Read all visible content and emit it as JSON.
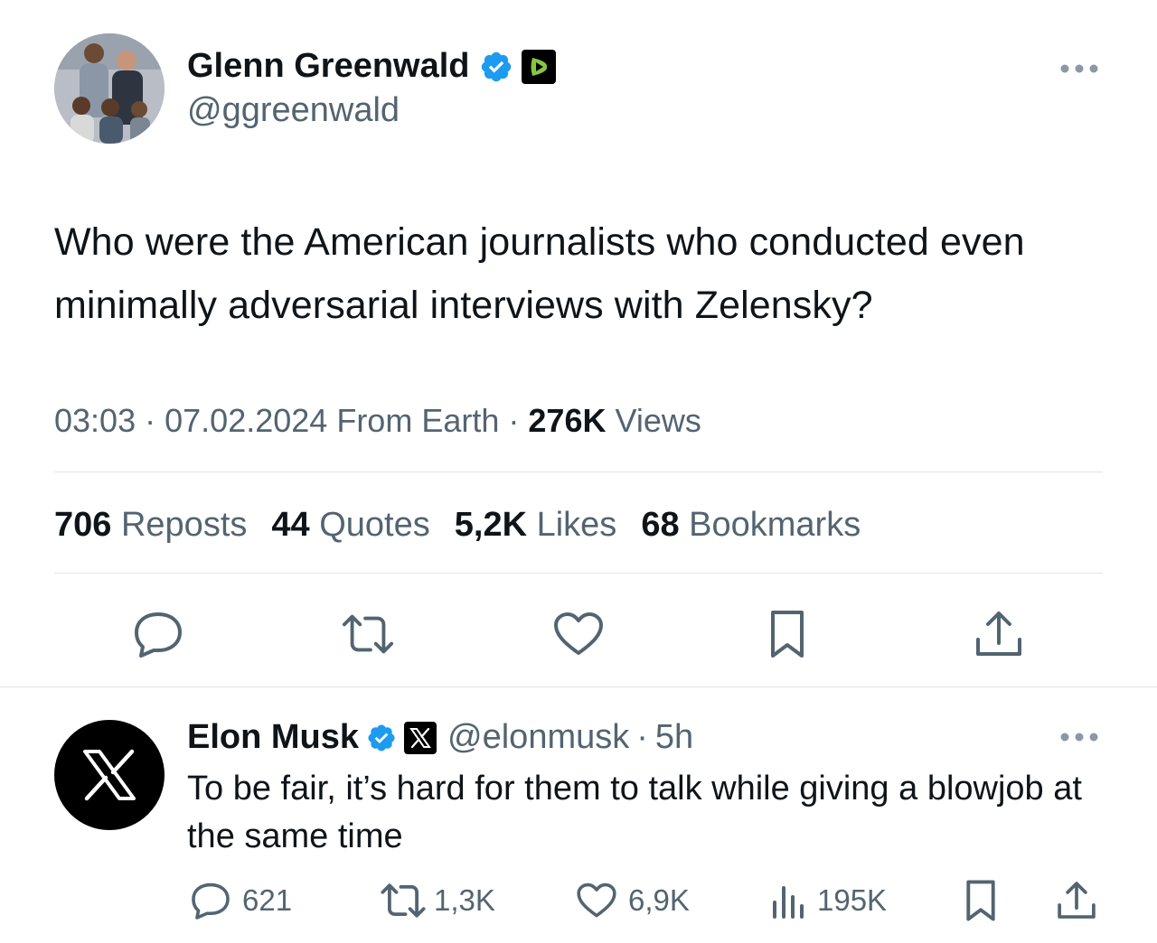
{
  "tweet": {
    "author_name": "Glenn Greenwald",
    "author_handle": "@ggreenwald",
    "text": "Who were the American journalists who conducted even minimally adversarial interviews with Zelensky?",
    "time": "03:03",
    "date": "07.02.2024",
    "source": "From Earth",
    "views_count": "276K",
    "views_label": "Views",
    "separator": "·",
    "stats": [
      {
        "count": "706",
        "label": "Reposts"
      },
      {
        "count": "44",
        "label": "Quotes"
      },
      {
        "count": "5,2K",
        "label": "Likes"
      },
      {
        "count": "68",
        "label": "Bookmarks"
      }
    ],
    "icons": [
      "reply-icon",
      "repost-icon",
      "like-icon",
      "bookmark-icon",
      "share-icon"
    ]
  },
  "reply": {
    "author_name": "Elon Musk",
    "author_handle": "@elonmusk",
    "age": "5h",
    "separator": "·",
    "text": "To be fair, it’s hard for them to talk while giving a blowjob at the same time",
    "actions": {
      "replies": "621",
      "reposts": "1,3K",
      "likes": "6,9K",
      "views": "195K"
    }
  },
  "colors": {
    "text_primary": "#0f1419",
    "text_secondary": "#536471",
    "verified_blue": "#1d9bf0",
    "rumble_green": "#85c742",
    "divider": "#e1e4e8"
  }
}
